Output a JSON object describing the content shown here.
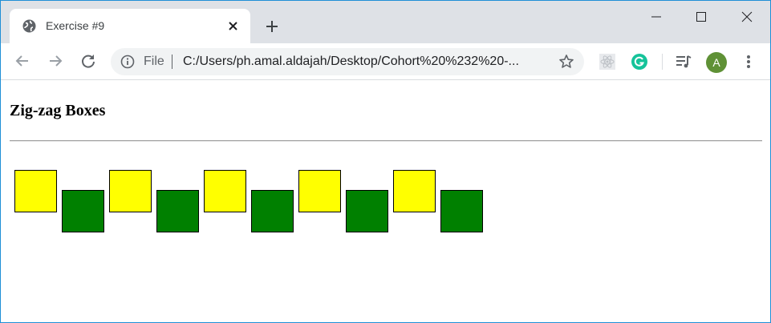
{
  "browser": {
    "tab": {
      "title": "Exercise #9"
    },
    "address": {
      "scheme_label": "File",
      "url": "C:/Users/ph.amal.aldajah/Desktop/Cohort%20%232%20-..."
    },
    "profile": {
      "initial": "A",
      "color": "#5f9136"
    }
  },
  "icons": [
    "globe-icon",
    "close-icon",
    "plus-icon",
    "minimize-icon",
    "maximize-icon",
    "window-close-icon",
    "back-arrow-icon",
    "forward-arrow-icon",
    "reload-icon",
    "info-icon",
    "star-icon",
    "react-devtools-icon",
    "grammarly-icon",
    "reading-list-icon",
    "kebab-menu-icon"
  ],
  "page": {
    "heading": "Zig-zag Boxes",
    "colors": {
      "yellow": "#ffff00",
      "green": "#008000"
    },
    "boxes": [
      {
        "color": "yellow",
        "row": "up"
      },
      {
        "color": "green",
        "row": "down"
      },
      {
        "color": "yellow",
        "row": "up"
      },
      {
        "color": "green",
        "row": "down"
      },
      {
        "color": "yellow",
        "row": "up"
      },
      {
        "color": "green",
        "row": "down"
      },
      {
        "color": "yellow",
        "row": "up"
      },
      {
        "color": "green",
        "row": "down"
      },
      {
        "color": "yellow",
        "row": "up"
      },
      {
        "color": "green",
        "row": "down"
      }
    ]
  }
}
